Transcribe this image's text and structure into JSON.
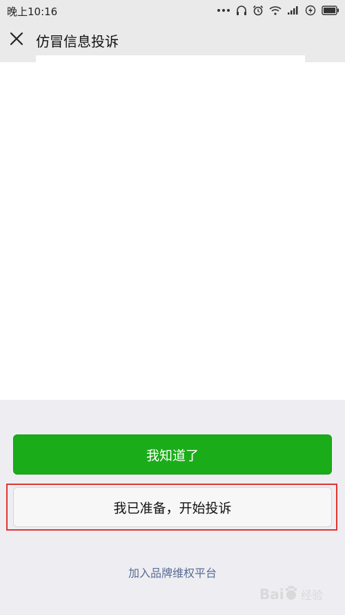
{
  "status_bar": {
    "time": "晚上10:16",
    "icons": [
      "more-icon",
      "headphones-icon",
      "alarm-icon",
      "wifi-icon",
      "signal-icon",
      "charging-icon",
      "battery-icon"
    ]
  },
  "nav": {
    "close_icon": "close-icon",
    "title": "仿冒信息投诉"
  },
  "actions": {
    "primary_label": "我知道了",
    "secondary_label": "我已准备，开始投诉",
    "link_label": "加入品牌维权平台"
  },
  "colors": {
    "primary": "#1aad19",
    "link": "#576b95",
    "highlight": "#e2332f"
  },
  "watermark": {
    "brand": "Baidu 经验"
  }
}
